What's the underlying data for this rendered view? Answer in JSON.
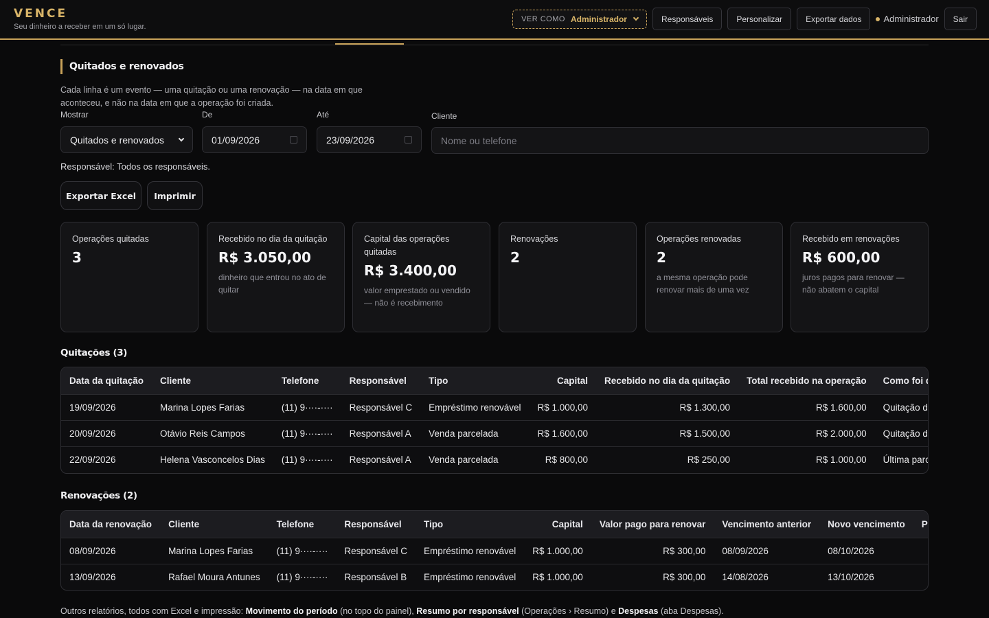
{
  "header": {
    "brand": "VENCE",
    "tagline": "Seu dinheiro a receber em um só lugar.",
    "view_as_label": "VER COMO",
    "view_as_value": "Administrador",
    "nav": [
      "Responsáveis",
      "Personalizar",
      "Exportar dados"
    ],
    "user": "Administrador",
    "logout": "Sair"
  },
  "section": {
    "title": "Quitados e renovados",
    "description": "Cada linha é um evento — uma quitação ou uma renovação — na data em que aconteceu, e não na data em que a operação foi criada."
  },
  "filters": {
    "show_label": "Mostrar",
    "show_value": "Quitados e renovados",
    "from_label": "De",
    "from_value": "01/09/2026",
    "to_label": "Até",
    "to_value": "23/09/2026",
    "client_label": "Cliente",
    "client_placeholder": "Nome ou telefone"
  },
  "responsible_line": "Responsável: Todos os responsáveis.",
  "actions": {
    "export": "Exportar Excel",
    "print": "Imprimir"
  },
  "cards": [
    {
      "title": "Operações quitadas",
      "value": "3",
      "note": ""
    },
    {
      "title": "Recebido no dia da quitação",
      "value": "R$ 3.050,00",
      "note": "dinheiro que entrou no ato de quitar"
    },
    {
      "title": "Capital das operações quitadas",
      "value": "R$ 3.400,00",
      "note": "valor emprestado ou vendido — não é recebimento"
    },
    {
      "title": "Renovações",
      "value": "2",
      "note": ""
    },
    {
      "title": "Operações renovadas",
      "value": "2",
      "note": "a mesma operação pode renovar mais de uma vez"
    },
    {
      "title": "Recebido em renovações",
      "value": "R$ 600,00",
      "note": "juros pagos para renovar — não abatem o capital"
    }
  ],
  "payoffs": {
    "title": "Quitações (3)",
    "columns": [
      "Data da quitação",
      "Cliente",
      "Telefone",
      "Responsável",
      "Tipo",
      "Capital",
      "Recebido no dia da quitação",
      "Total recebido na operação",
      "Como foi quitada"
    ],
    "rows": [
      [
        "19/09/2026",
        "Marina Lopes Farias",
        "(11) 9····-····",
        "Responsável C",
        "Empréstimo renovável",
        "R$ 1.000,00",
        "R$ 1.300,00",
        "R$ 1.600,00",
        "Quitação direta"
      ],
      [
        "20/09/2026",
        "Otávio Reis Campos",
        "(11) 9····-····",
        "Responsável A",
        "Venda parcelada",
        "R$ 1.600,00",
        "R$ 1.500,00",
        "R$ 2.000,00",
        "Quitação direta"
      ],
      [
        "22/09/2026",
        "Helena Vasconcelos Dias",
        "(11) 9····-····",
        "Responsável A",
        "Venda parcelada",
        "R$ 800,00",
        "R$ 250,00",
        "R$ 1.000,00",
        "Última parcela"
      ]
    ]
  },
  "renewals": {
    "title": "Renovações (2)",
    "columns": [
      "Data da renovação",
      "Cliente",
      "Telefone",
      "Responsável",
      "Tipo",
      "Capital",
      "Valor pago para renovar",
      "Vencimento anterior",
      "Novo vencimento",
      "Pago"
    ],
    "rows": [
      [
        "08/09/2026",
        "Marina Lopes Farias",
        "(11) 9····-····",
        "Responsável C",
        "Empréstimo renovável",
        "R$ 1.000,00",
        "R$ 300,00",
        "08/09/2026",
        "08/10/2026",
        ""
      ],
      [
        "13/09/2026",
        "Rafael Moura Antunes",
        "(11) 9····-····",
        "Responsável B",
        "Empréstimo renovável",
        "R$ 1.000,00",
        "R$ 300,00",
        "14/08/2026",
        "13/10/2026",
        ""
      ]
    ]
  },
  "footer": {
    "prefix": "Outros relatórios, todos com Excel e impressão: ",
    "r1": "Movimento do período",
    "r1_note": " (no topo do painel), ",
    "r2": "Resumo por responsável",
    "r2_note": " (Operações › Resumo) e ",
    "r3": "Despesas",
    "r3_note": " (aba Despesas)."
  }
}
